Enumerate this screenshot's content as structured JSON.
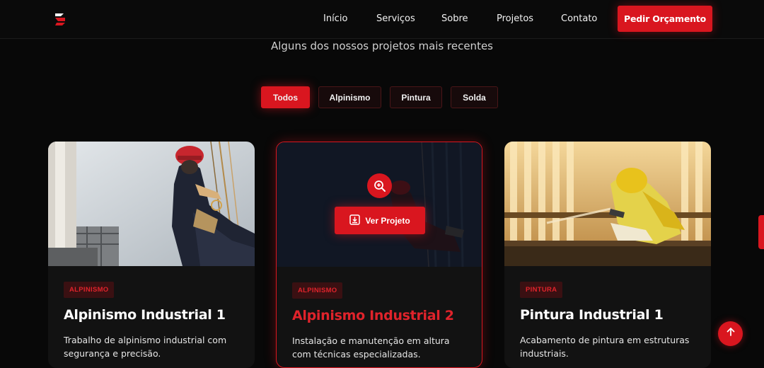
{
  "nav": {
    "links": [
      "Início",
      "Serviços",
      "Sobre",
      "Projetos",
      "Contato"
    ],
    "cta_label": "Pedir Orçamento"
  },
  "section": {
    "subtitle": "Alguns dos nossos projetos mais recentes"
  },
  "filters": [
    {
      "label": "Todos",
      "active": true
    },
    {
      "label": "Alpinismo",
      "active": false
    },
    {
      "label": "Pintura",
      "active": false
    },
    {
      "label": "Solda",
      "active": false
    }
  ],
  "projects": [
    {
      "category": "ALPINISMO",
      "title": "Alpinismo Industrial 1",
      "description": "Trabalho de alpinismo industrial com segurança e precisão."
    },
    {
      "category": "ALPINISMO",
      "title": "Alpinismo Industrial 2",
      "description": "Instalação e manutenção em altura com técnicas especializadas.",
      "hover_action_label": "Ver Projeto"
    },
    {
      "category": "PINTURA",
      "title": "Pintura Industrial 1",
      "description": "Acabamento de pintura em estruturas industriais."
    }
  ],
  "colors": {
    "accent": "#d9161f",
    "background": "#080808",
    "card": "#121212"
  },
  "icons": {
    "logo": "brand-logo-icon",
    "zoom": "zoom-in-icon",
    "view": "download-box-icon",
    "scroll_top": "arrow-up-icon"
  }
}
